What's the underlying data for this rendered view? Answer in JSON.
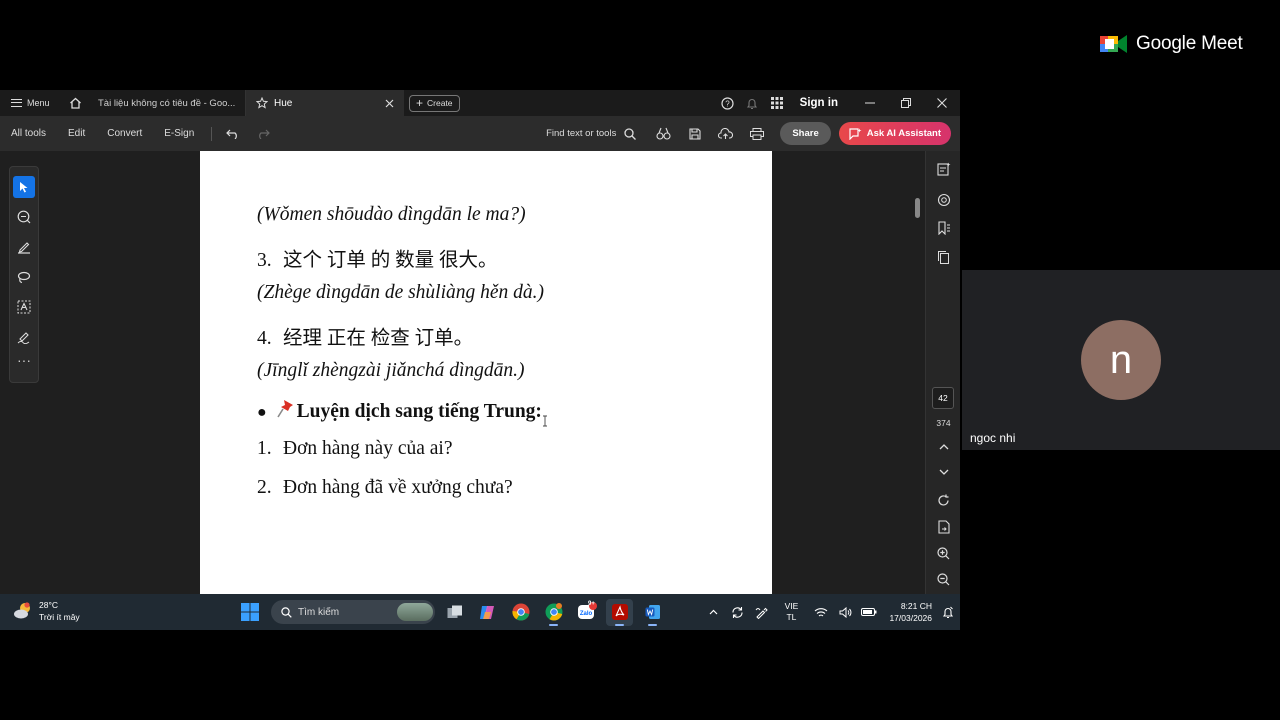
{
  "meet": {
    "brand": "Google Meet",
    "participant": {
      "initial": "n",
      "name": "ngoc nhi"
    }
  },
  "acrobat": {
    "tabbar": {
      "menu_label": "Menu",
      "tabs": [
        {
          "label": "Tài liệu không có tiêu đề - Goo..."
        },
        {
          "label": "Hue"
        }
      ],
      "create_label": "Create",
      "sign_in": "Sign in"
    },
    "toolbar": {
      "items": [
        "All tools",
        "Edit",
        "Convert",
        "E-Sign"
      ],
      "find_label": "Find text or tools",
      "share_label": "Share",
      "ai_label": "Ask AI Assistant"
    },
    "page_nav": {
      "current": "42",
      "total": "374"
    }
  },
  "document": {
    "lines": [
      {
        "text": "(Wǒmen shōudào dìngdān le ma?)"
      },
      {
        "num": "3.",
        "text": "这个 订单 的 数量 很大。"
      },
      {
        "text": "(Zhège dìngdān de shùliàng hěn dà.)"
      },
      {
        "num": "4.",
        "text": "经理 正在 检查 订单。"
      },
      {
        "text": "(Jīnglǐ zhèngzài jiǎnchá dìngdān.)"
      },
      {
        "bullet": "●",
        "text": "Luyện dịch sang tiếng Trung:"
      },
      {
        "num": "1.",
        "text": "Đơn hàng này của ai?"
      },
      {
        "num": "2.",
        "text": "Đơn hàng đã về xưởng chưa?"
      }
    ]
  },
  "taskbar": {
    "weather": {
      "temp": "28°C",
      "desc": "Trời ít mây"
    },
    "search_placeholder": "Tìm kiếm",
    "notification_badge": "9+",
    "lang": [
      "VIE",
      "TL"
    ],
    "time": "8:21 CH",
    "date": "17/03/2026"
  }
}
